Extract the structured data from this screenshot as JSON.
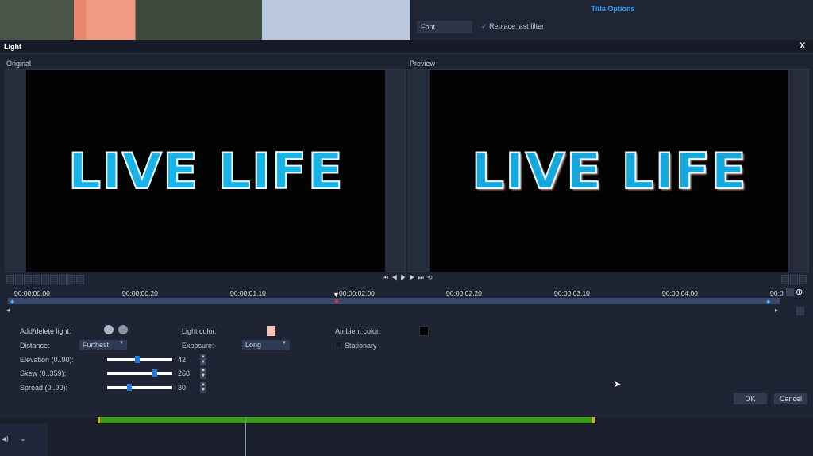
{
  "background": {
    "title_options": "Title Options",
    "font_tab": "Font",
    "replace_last_filter": "Replace last filter",
    "replace_checked": true
  },
  "dialog": {
    "title": "Light",
    "close": "X",
    "original_label": "Original",
    "preview_label": "Preview",
    "video_text": "LIVE LIFE"
  },
  "timeline": {
    "ticks": [
      "00:00:00.00",
      "00:00:00.20",
      "00:00:01.10",
      "00:00:02.00",
      "00:00:02.20",
      "00:00:03.10",
      "00:00:04.00",
      "00:0"
    ]
  },
  "controls": {
    "add_delete_light": "Add/delete light:",
    "light_color_label": "Light color:",
    "light_color": "#f7c3b4",
    "ambient_color_label": "Ambient color:",
    "ambient_color": "#000000",
    "distance_label": "Distance:",
    "distance_value": "Furthest",
    "exposure_label": "Exposure:",
    "exposure_value": "Long",
    "stationary_label": "Stationary",
    "stationary_checked": false,
    "sliders": [
      {
        "label": "Elevation (0..90):",
        "value": "42",
        "min": 0,
        "max": 90
      },
      {
        "label": "Skew (0..359):",
        "value": "268",
        "min": 0,
        "max": 359
      },
      {
        "label": "Spread (0..90):",
        "value": "30",
        "min": 0,
        "max": 90
      }
    ]
  },
  "buttons": {
    "ok": "OK",
    "cancel": "Cancel"
  }
}
